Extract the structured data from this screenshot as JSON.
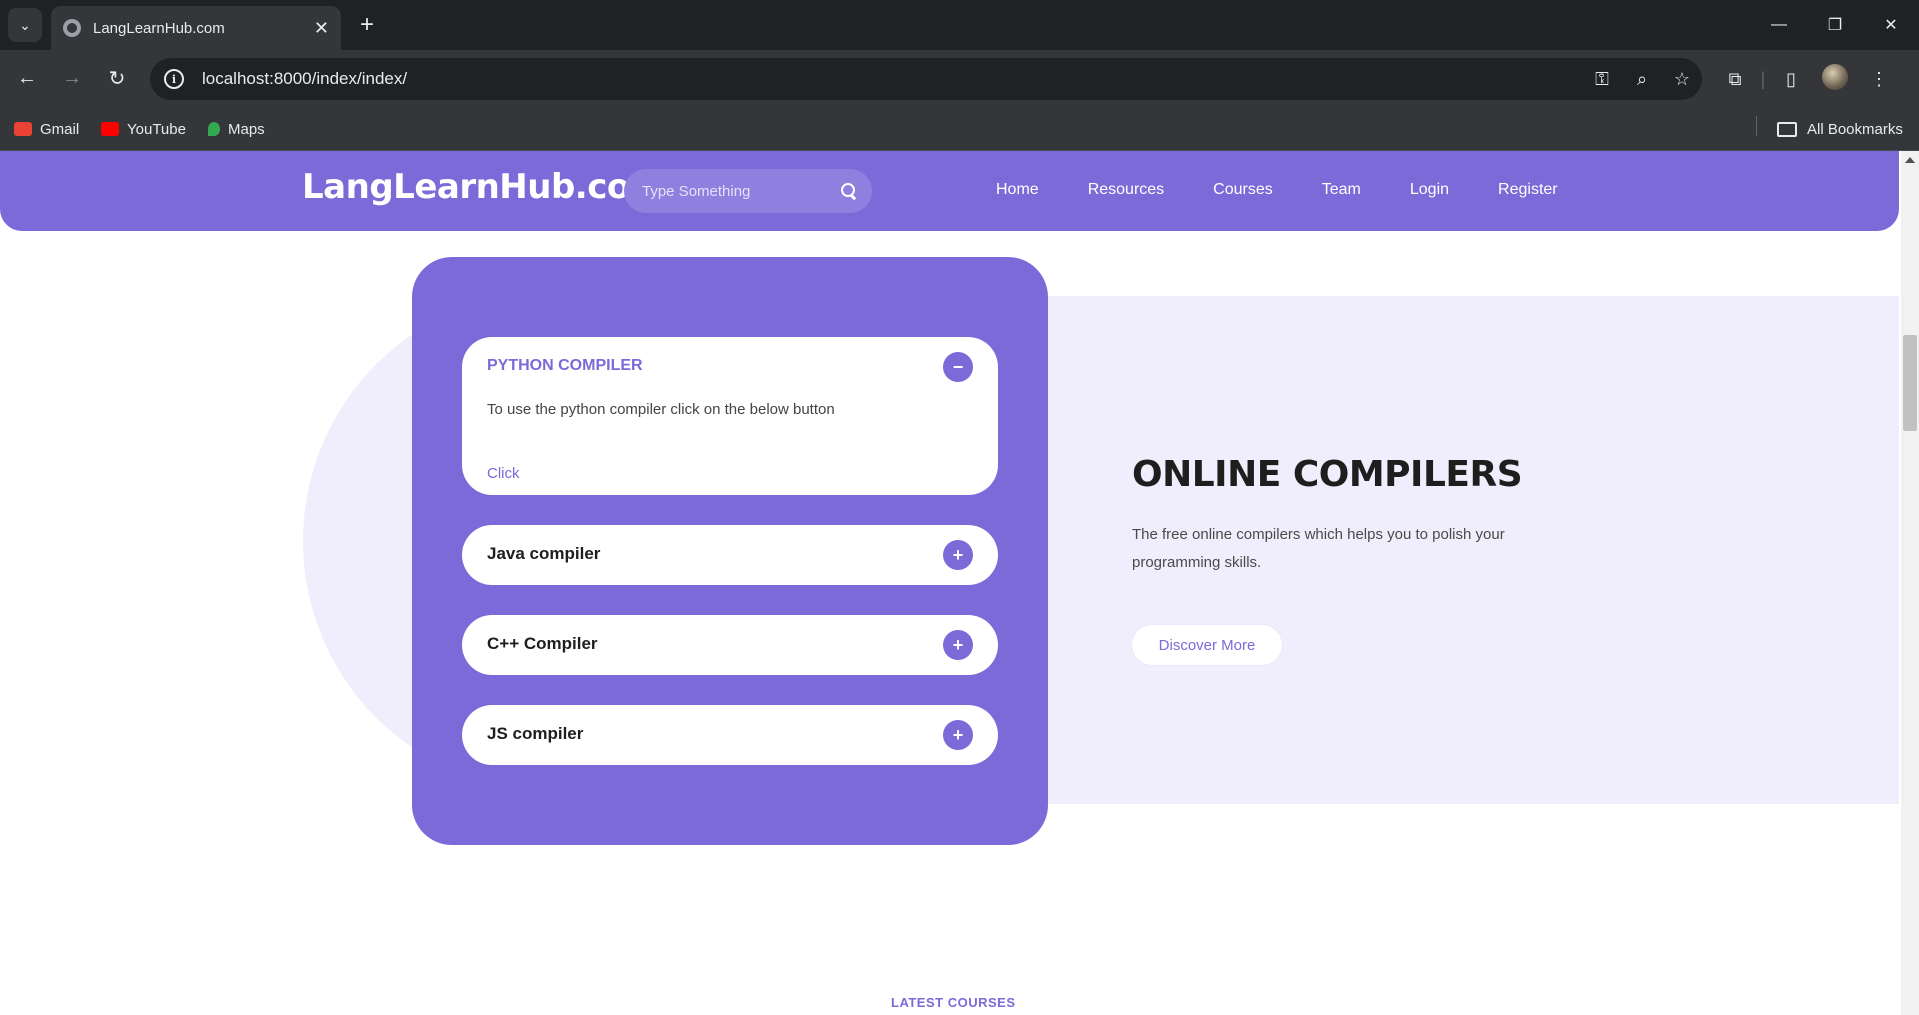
{
  "browser": {
    "tab_title": "LangLearnHub.com",
    "url": "localhost:8000/index/index/",
    "bookmarks": [
      {
        "label": "Gmail",
        "color": "#ea4335"
      },
      {
        "label": "YouTube",
        "color": "#ff0000"
      },
      {
        "label": "Maps",
        "color": "#34a853"
      }
    ],
    "all_bookmarks_label": "All Bookmarks"
  },
  "site": {
    "logo": "LangLearnHub.com",
    "search_placeholder": "Type Something",
    "nav": [
      "Home",
      "Resources",
      "Courses",
      "Team",
      "Login",
      "Register"
    ],
    "accent_color": "#7b6ad8"
  },
  "accordion": {
    "items": [
      {
        "title": "PYTHON COMPILER",
        "expanded": true,
        "body": "To use the python compiler click on the below button",
        "link": "Click"
      },
      {
        "title": "Java compiler",
        "expanded": false
      },
      {
        "title": "C++ Compiler",
        "expanded": false
      },
      {
        "title": "JS compiler",
        "expanded": false
      }
    ]
  },
  "section": {
    "title": "ONLINE COMPILERS",
    "description": "The free online compilers which helps you to polish your programming skills.",
    "button": "Discover More",
    "next_section_label": "LATEST COURSES"
  }
}
